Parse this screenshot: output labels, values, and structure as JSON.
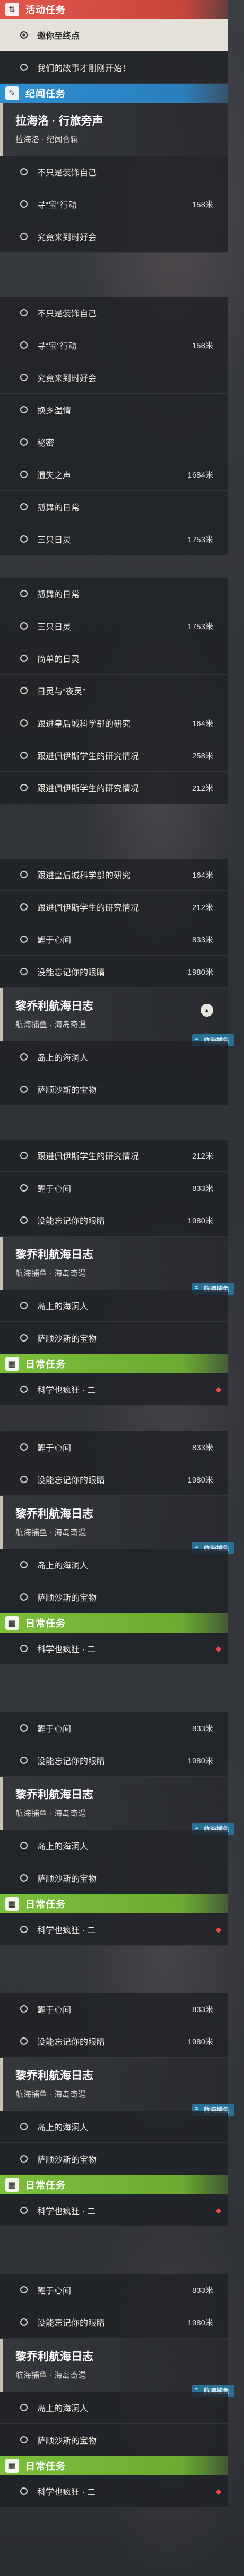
{
  "categories": {
    "event": "活动任务",
    "story": "纪闻任务",
    "daily": "日常任务"
  },
  "event_quests": {
    "q1": "邀你至终点",
    "q2": "我们的故事才刚刚开始！"
  },
  "story_quest": {
    "title": "拉海洛 · 行旅旁声",
    "sub": "拉海洛 · 纪闻合辑"
  },
  "story_items": [
    {
      "label": "不只是装饰自己",
      "dist": ""
    },
    {
      "label": "寻“宝”行动",
      "dist": "158米"
    },
    {
      "label": "究竟来到时好会",
      "dist": ""
    },
    {
      "label": "不只是装饰自己",
      "dist": ""
    },
    {
      "label": "寻“宝”行动",
      "dist": "158米"
    },
    {
      "label": "究竟来到时好会",
      "dist": ""
    },
    {
      "label": "换乡温情",
      "dist": ""
    },
    {
      "label": "秘密",
      "dist": ""
    },
    {
      "label": "遗失之声",
      "dist": "1684米"
    },
    {
      "label": "孤舞的日常",
      "dist": ""
    },
    {
      "label": "三只日灵",
      "dist": "1753米"
    },
    {
      "label": "孤舞的日常",
      "dist": ""
    },
    {
      "label": "三只日灵",
      "dist": "1753米"
    },
    {
      "label": "简单的日灵",
      "dist": ""
    },
    {
      "label": "日灵与“夜灵”",
      "dist": ""
    },
    {
      "label": "跟进皇后城科学部的研究",
      "dist": "164米"
    },
    {
      "label": "跟进佩伊斯学生的研究情况",
      "dist": "258米"
    },
    {
      "label": "跟进佩伊斯学生的研究情况",
      "dist": "212米"
    },
    {
      "label": "跟进皇后城科学部的研究",
      "dist": "164米"
    },
    {
      "label": "跟进佩伊斯学生的研究情况",
      "dist": "212米"
    },
    {
      "label": "鲤于心间",
      "dist": "833米"
    },
    {
      "label": "没能忘记你的眼睛",
      "dist": "1980米"
    }
  ],
  "voyage": {
    "title": "黎乔利航海日志",
    "sub": "航海捕鱼 · 海岛奇遇",
    "tag": "航海捕鱼",
    "items": [
      "岛上的海洞人",
      "萨顺沙斯的宝物"
    ]
  },
  "repeat_items": [
    {
      "label": "跟进佩伊斯学生的研究情况",
      "dist": "212米"
    },
    {
      "label": "鲤于心间",
      "dist": "833米"
    },
    {
      "label": "没能忘记你的眼睛",
      "dist": "1980米"
    }
  ],
  "daily_item": "科学也疯狂 · 二"
}
